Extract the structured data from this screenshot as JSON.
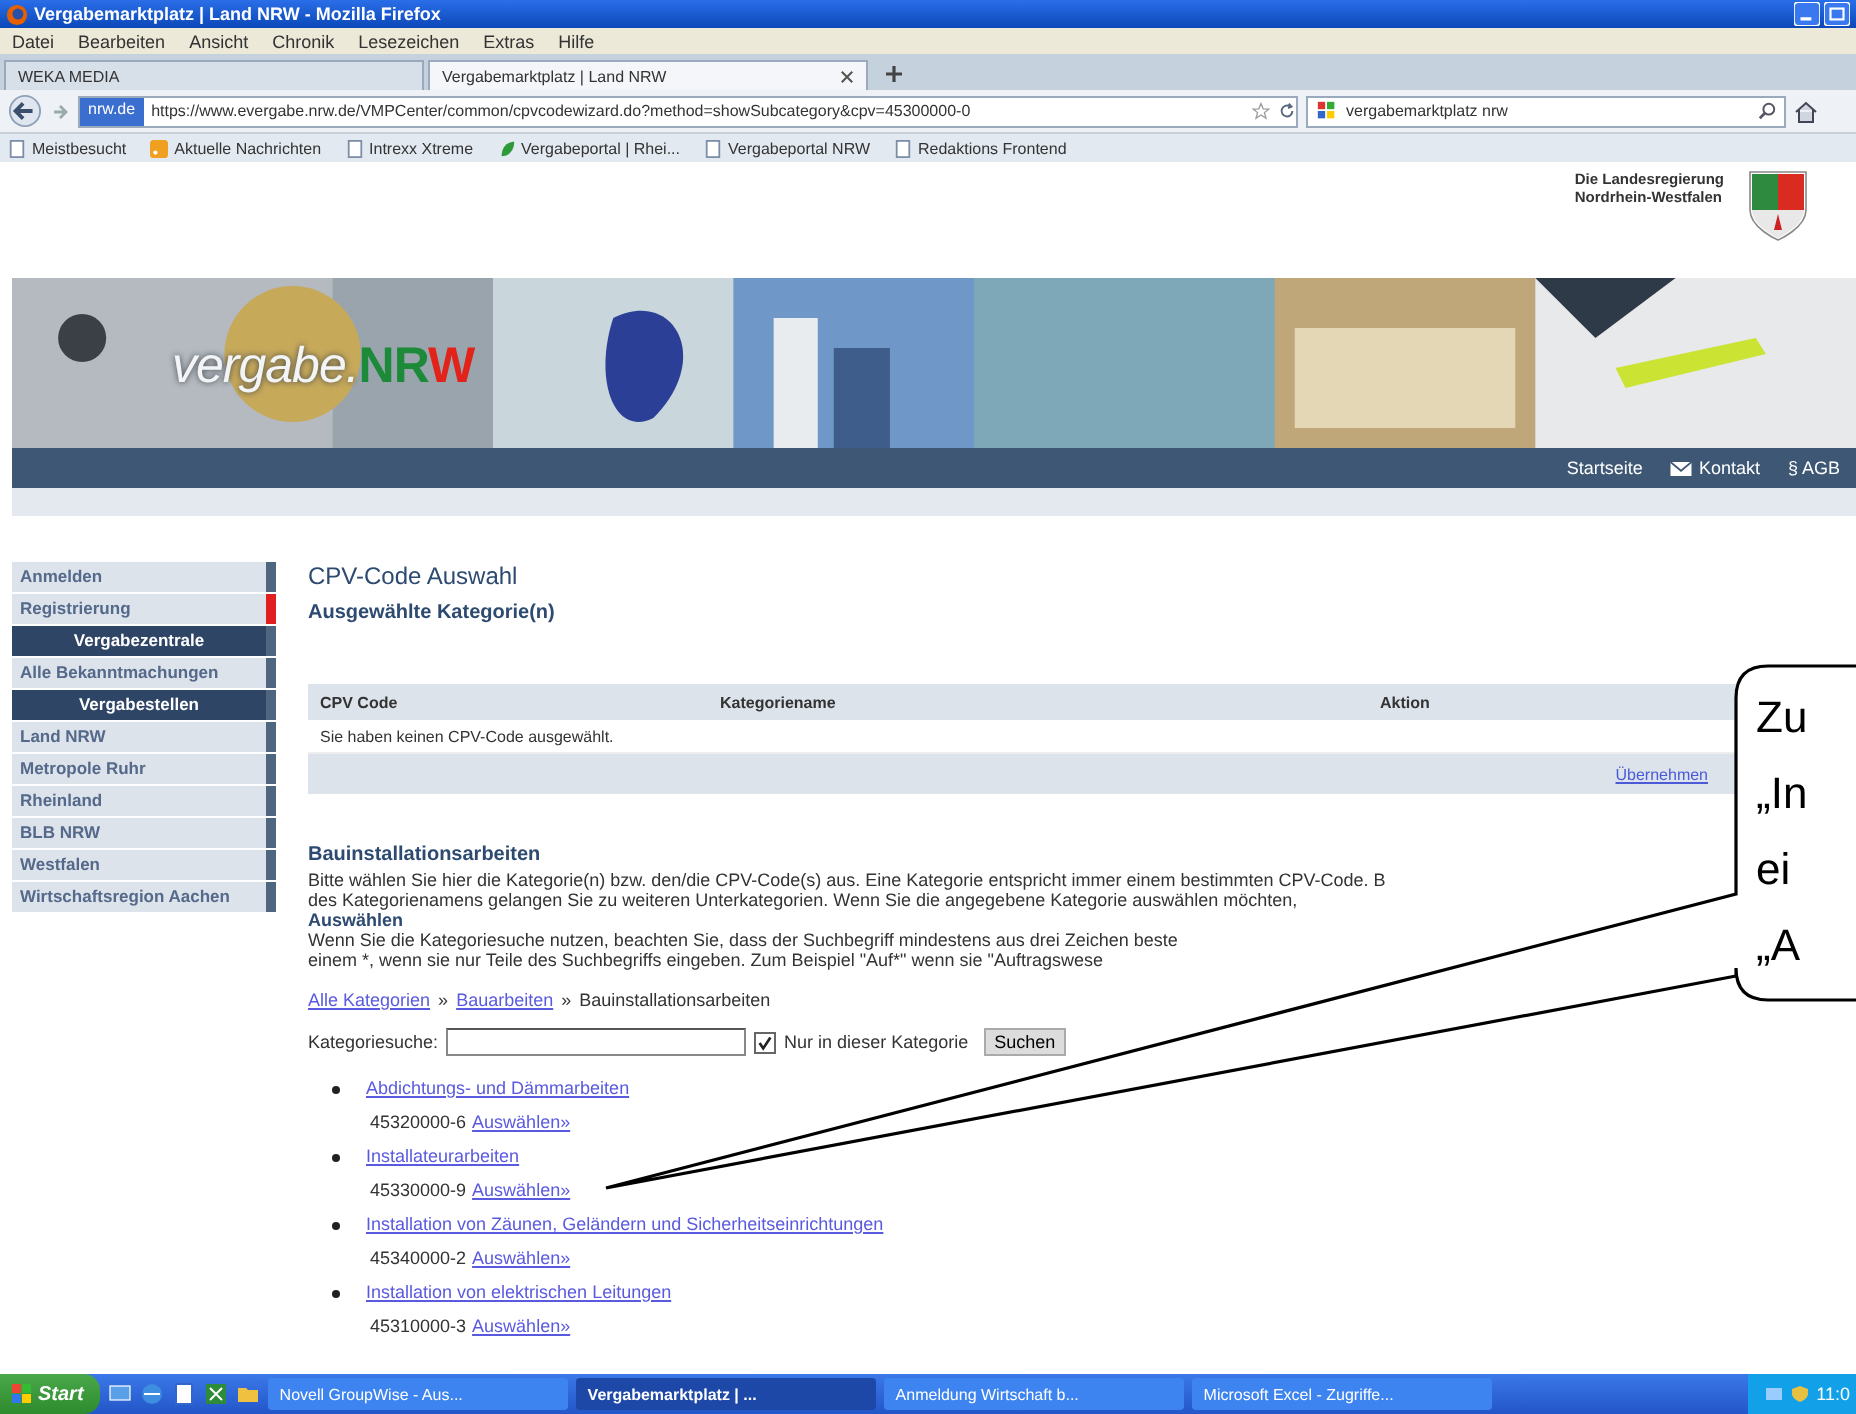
{
  "browser": {
    "title": "Vergabemarktplatz | Land NRW - Mozilla Firefox",
    "menu": [
      "Datei",
      "Bearbeiten",
      "Ansicht",
      "Chronik",
      "Lesezeichen",
      "Extras",
      "Hilfe"
    ],
    "tabs": [
      {
        "label": "WEKA MEDIA",
        "selected": false
      },
      {
        "label": "Vergabemarktplatz | Land NRW",
        "selected": true
      }
    ],
    "identity": "nrw.de",
    "url": "https://www.evergabe.nrw.de/VMPCenter/common/cpvcodewizard.do?method=showSubcategory&cpv=45300000-0",
    "search": "vergabemarktplatz nrw",
    "bookmarks": [
      {
        "label": "Meistbesucht",
        "kind": "page"
      },
      {
        "label": "Aktuelle Nachrichten",
        "kind": "feed"
      },
      {
        "label": "Intrexx Xtreme",
        "kind": "page"
      },
      {
        "label": "Vergabeportal | Rhei...",
        "kind": "leaf"
      },
      {
        "label": "Vergabeportal NRW",
        "kind": "page"
      },
      {
        "label": "Redaktions Frontend",
        "kind": "page"
      }
    ]
  },
  "page": {
    "government": [
      "Die Landesregierung",
      "Nordrhein-Westfalen"
    ],
    "logo": {
      "prefix": "vergabe.",
      "letters": [
        {
          "text": "N",
          "color": "#1d8a3a"
        },
        {
          "text": "R",
          "color": "#1d8a3a"
        },
        {
          "text": "W",
          "color": "#e2231a"
        }
      ]
    },
    "top_nav": [
      {
        "label": "Startseite",
        "kind": "plain"
      },
      {
        "label": "Kontakt",
        "kind": "mail"
      },
      {
        "label": "§ AGB",
        "kind": "plain"
      }
    ]
  },
  "sidebar": [
    {
      "label": "Anmelden",
      "kind": "link",
      "selected": false
    },
    {
      "label": "Registrierung",
      "kind": "link",
      "selected": true
    },
    {
      "label": "Vergabezentrale",
      "kind": "header",
      "selected": false
    },
    {
      "label": "Alle Bekanntmachungen",
      "kind": "link",
      "selected": false
    },
    {
      "label": "Vergabestellen",
      "kind": "header",
      "selected": false
    },
    {
      "label": "Land NRW",
      "kind": "link",
      "selected": false
    },
    {
      "label": "Metropole Ruhr",
      "kind": "link",
      "selected": false
    },
    {
      "label": "Rheinland",
      "kind": "link",
      "selected": false
    },
    {
      "label": "BLB NRW",
      "kind": "link",
      "selected": false
    },
    {
      "label": "Westfalen",
      "kind": "link",
      "selected": false
    },
    {
      "label": "Wirtschaftsregion Aachen",
      "kind": "link",
      "selected": false
    }
  ],
  "content": {
    "title": "CPV-Code Auswahl",
    "selected_heading": "Ausgewählte Kategorie(n)",
    "table": {
      "columns": [
        "CPV Code",
        "Kategoriename",
        "Aktion"
      ],
      "empty_message": "Sie haben keinen CPV-Code ausgewählt.",
      "footer_link": "Übernehmen"
    },
    "section_title": "Bauinstallationsarbeiten",
    "intro_lines": [
      "Bitte wählen Sie hier die Kategorie(n) bzw. den/die CPV-Code(s) aus. Eine Kategorie entspricht immer einem bestimmten CPV-Code. B",
      "des Kategorienamens gelangen Sie zu weiteren Unterkategorien. Wenn Sie die angegebene Kategorie auswählen möchten,"
    ],
    "select_heading": "Auswählen",
    "search_lines": [
      "Wenn Sie die Kategoriesuche nutzen, beachten Sie, dass der Suchbegriff mindestens aus drei Zeichen beste",
      "einem *, wenn sie nur Teile des Suchbegriffs eingeben. Zum Beispiel \"Auf*\" wenn sie \"Auftragswese"
    ],
    "breadcrumb": [
      {
        "label": "Alle Kategorien",
        "kind": "link"
      },
      {
        "label": "Bauarbeiten",
        "kind": "link"
      },
      {
        "label": "Bauinstallationsarbeiten",
        "kind": "current"
      }
    ],
    "breadcrumb_separator": "»",
    "search": {
      "label": "Kategoriesuche:",
      "checkbox_label": "Nur in dieser Kategorie",
      "checked": true,
      "button": "Suchen"
    },
    "categories": [
      {
        "name": "Abdichtungs- und Dämmarbeiten",
        "code": "45320000-6",
        "action": "Auswählen»"
      },
      {
        "name": "Installateurarbeiten",
        "code": "45330000-9",
        "action": "Auswählen»"
      },
      {
        "name": "Installation von Zäunen, Geländern und Sicherheitseinrichtungen",
        "code": "45340000-2",
        "action": "Auswählen»"
      },
      {
        "name": "Installation von elektrischen Leitungen",
        "code": "45310000-3",
        "action": "Auswählen»"
      }
    ]
  },
  "callout": {
    "lines": [
      "Zu",
      "„In",
      "ei",
      "„A"
    ]
  },
  "taskbar": {
    "start": "Start",
    "tasks": [
      {
        "label": "Novell GroupWise - Aus...",
        "selected": false
      },
      {
        "label": "Vergabemarktplatz | ...",
        "selected": true
      },
      {
        "label": "Anmeldung Wirtschaft b...",
        "selected": false
      },
      {
        "label": "Microsoft Excel - Zugriffe...",
        "selected": false
      }
    ],
    "clock": "11:0"
  }
}
